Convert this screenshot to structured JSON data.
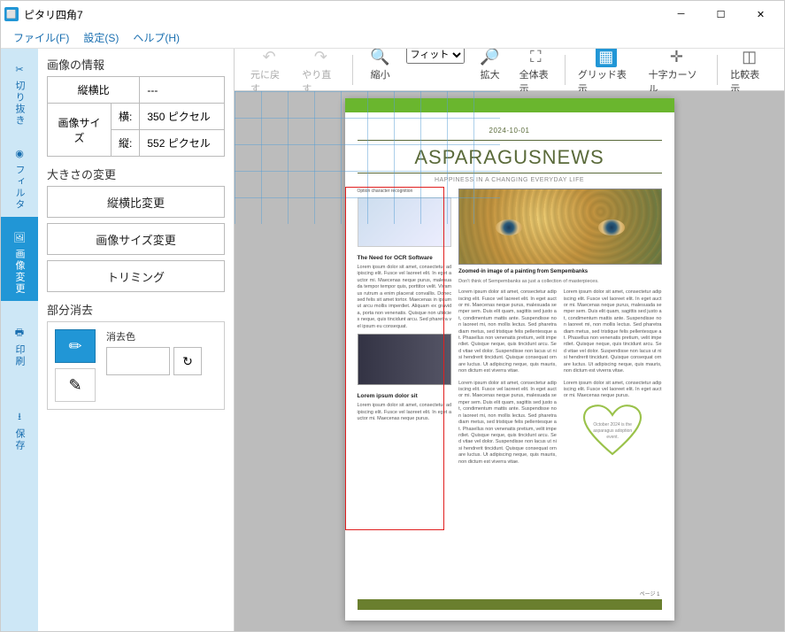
{
  "window": {
    "title": "ピタリ四角7"
  },
  "menu": {
    "file": "ファイル(F)",
    "settings": "設定(S)",
    "help": "ヘルプ(H)"
  },
  "sidebar_tabs": {
    "crop": "切り抜き",
    "filter": "フィルタ",
    "image_change": "画像変更",
    "print": "印刷",
    "save": "保存"
  },
  "side_panel": {
    "info_title": "画像の情報",
    "aspect_label": "縦横比",
    "aspect_value": "---",
    "size_label": "画像サイズ",
    "width_label": "横:",
    "width_value": "350 ピクセル",
    "height_label": "縦:",
    "height_value": "552 ピクセル",
    "resize_title": "大きさの変更",
    "btn_aspect": "縦横比変更",
    "btn_size": "画像サイズ変更",
    "btn_trim": "トリミング",
    "erase_title": "部分消去",
    "erase_color_label": "消去色"
  },
  "toolbar": {
    "undo": "元に戻す",
    "redo": "やり直す",
    "zoom_out": "縮小",
    "fit": "フィット",
    "zoom_in": "拡大",
    "fit_all": "全体表示",
    "grid": "グリッド表示",
    "cross": "十字カーソル",
    "compare": "比較表示"
  },
  "document": {
    "date": "2024-10-01",
    "title": "ASPARAGUSNEWS",
    "subtitle": "HAPPINESS IN A CHANGING EVERYDAY LIFE",
    "col1_subhead": "The Need for OCR Software",
    "col1_subhead2": "Lorem ipsum dolor sit",
    "painting_caption": "Zoomed-in image of a painting from Sempembanks",
    "painting_sub": "Don't think of Sempembanks as just a collection of masterpieces.",
    "heart_text": "October 2024 is the asparagus adoption event.",
    "page_num": "ページ 1",
    "lorem_short": "Lorem ipsum dolor sit amet, consectetur adipiscing elit. Fusce vel laoreet elit. In eget auctor mi. Maecenas neque purus.",
    "lorem_med": "Lorem ipsum dolor sit amet, consectetur adipiscing elit. Fusce vel laoreet elit. In eget auctor mi. Maecenas neque purus, malesuada tempor tempor quis, porttitor velit. Vivamus rutrum a enim placerat convallis. Donec sed felis sit amet tortor. Maecenas in ipsum ut arcu mollis imperdiet. Aliquam ex gravida, porta non venenatis. Quisque non ultricies neque, quis tincidunt arcu. Sed pharetra vel ipsum eu consequat.",
    "lorem_long": "Lorem ipsum dolor sit amet, consectetur adipiscing elit. Fusce vel laoreet elit. In eget auctor mi. Maecenas neque purus, malesuada semper sem. Duis elit quam, sagittis sed justo at, condimentum mattis ante. Suspendisse non laoreet mi, non mollis lectus. Sed pharetra diam metus, sed tristique felis pellentesque at. Phasellus non venenatis pretium, velit imperdiet. Quisque neque, quis tincidunt arcu. Sed vitae vel dolor. Suspendisse non lacus ut nisi hendrerit tincidunt. Quisque consequat ornare luctus. Ut adipiscing neque, quis mauris, non dictum est viverra vitae."
  }
}
